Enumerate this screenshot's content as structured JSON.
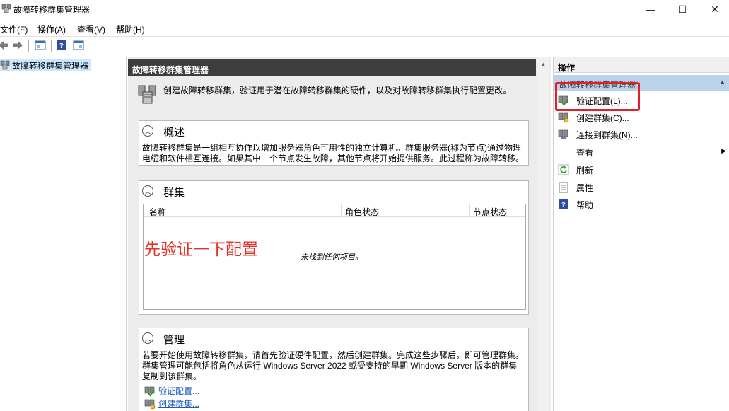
{
  "window": {
    "title": "故障转移群集管理器",
    "minimize": "—",
    "maximize": "☐",
    "close": "✕"
  },
  "menu": {
    "file": "文件(F)",
    "action": "操作(A)",
    "view": "查看(V)",
    "help": "帮助(H)"
  },
  "tree": {
    "root_label": "故障转移群集管理器"
  },
  "center": {
    "header": "故障转移群集管理器",
    "intro": "创建故障转移群集，验证用于潜在故障转移群集的硬件，以及对故障转移群集执行配置更改。",
    "overview": {
      "title": "概述",
      "line1": "故障转移群集是一组相互协作以增加服务器角色可用性的独立计算机。群集服务器(称为节点)通过物理",
      "line2": "电缆和软件相互连接。如果其中一个节点发生故障，其他节点将开始提供服务。此过程称为故障转移。"
    },
    "clusters": {
      "title": "群集",
      "col_name": "名称",
      "col_role_status": "角色状态",
      "col_node_status": "节点状态",
      "empty": "未找到任何项目。",
      "annotation": "先验证一下配置"
    },
    "management": {
      "title": "管理",
      "line1": "若要开始使用故障转移群集，请首先验证硬件配置，然后创建群集。完成这些步骤后，即可管理群集。",
      "line2": "群集管理可能包括将角色从运行 Windows Server 2022 或受支持的早期 Windows Server 版本的群集",
      "line3": "复制到该群集。",
      "link_validate": "验证配置...",
      "link_create": "创建群集..."
    }
  },
  "actions": {
    "header": "操作",
    "section": "故障转移群集管理器",
    "items": [
      {
        "label": "验证配置(L)...",
        "icon": "validate-config-icon"
      },
      {
        "label": "创建群集(C)...",
        "icon": "create-cluster-icon"
      },
      {
        "label": "连接到群集(N)...",
        "icon": "connect-cluster-icon"
      },
      {
        "label": "查看",
        "icon": "none"
      },
      {
        "label": "刷新",
        "icon": "refresh-icon"
      },
      {
        "label": "属性",
        "icon": "properties-icon"
      },
      {
        "label": "帮助",
        "icon": "help-icon"
      }
    ]
  },
  "colors": {
    "highlight": "#e41e26",
    "annotation": "#e43125",
    "center_header_bg": "#3d3d3d",
    "actions_section_bg": "#bcd1ea"
  }
}
